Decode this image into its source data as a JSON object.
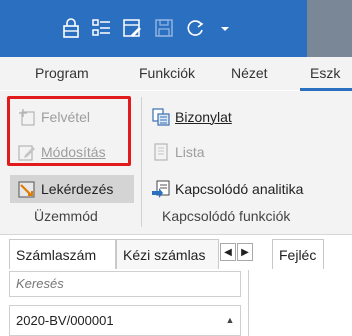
{
  "quick_access": {
    "icons": [
      "lock-icon",
      "list-icon",
      "edit-form-icon",
      "save-icon",
      "refresh-icon",
      "dropdown-arrow-icon"
    ]
  },
  "menu": {
    "items": [
      {
        "label": "Program"
      },
      {
        "label": "Funkciók"
      },
      {
        "label": "Nézet"
      },
      {
        "label": "Eszk"
      }
    ]
  },
  "ribbon": {
    "felvetel": "Felvétel",
    "modositas": "Módosítás",
    "lekerdezes": "Lekérdezés",
    "bizonylat": "Bizonylat",
    "lista": "Lista",
    "kapcsolodo": "Kapcsolódó analitika",
    "group_uzemmod": "Üzemmód",
    "group_kapcsolodo": "Kapcsolódó funkciók"
  },
  "tabs": {
    "szamlaszam": "Számlaszám",
    "kezi": "Kézi számlas",
    "fejlec": "Fejléc",
    "left_arrow": "◀",
    "right_arrow": "▶"
  },
  "search": {
    "placeholder": "Keresés"
  },
  "list": {
    "rows": [
      {
        "value": "2020-BV/000001"
      }
    ],
    "scroll_up": "▲"
  },
  "colors": {
    "title_blue": "#2b6fc0",
    "highlight_red": "#e11b1b"
  }
}
